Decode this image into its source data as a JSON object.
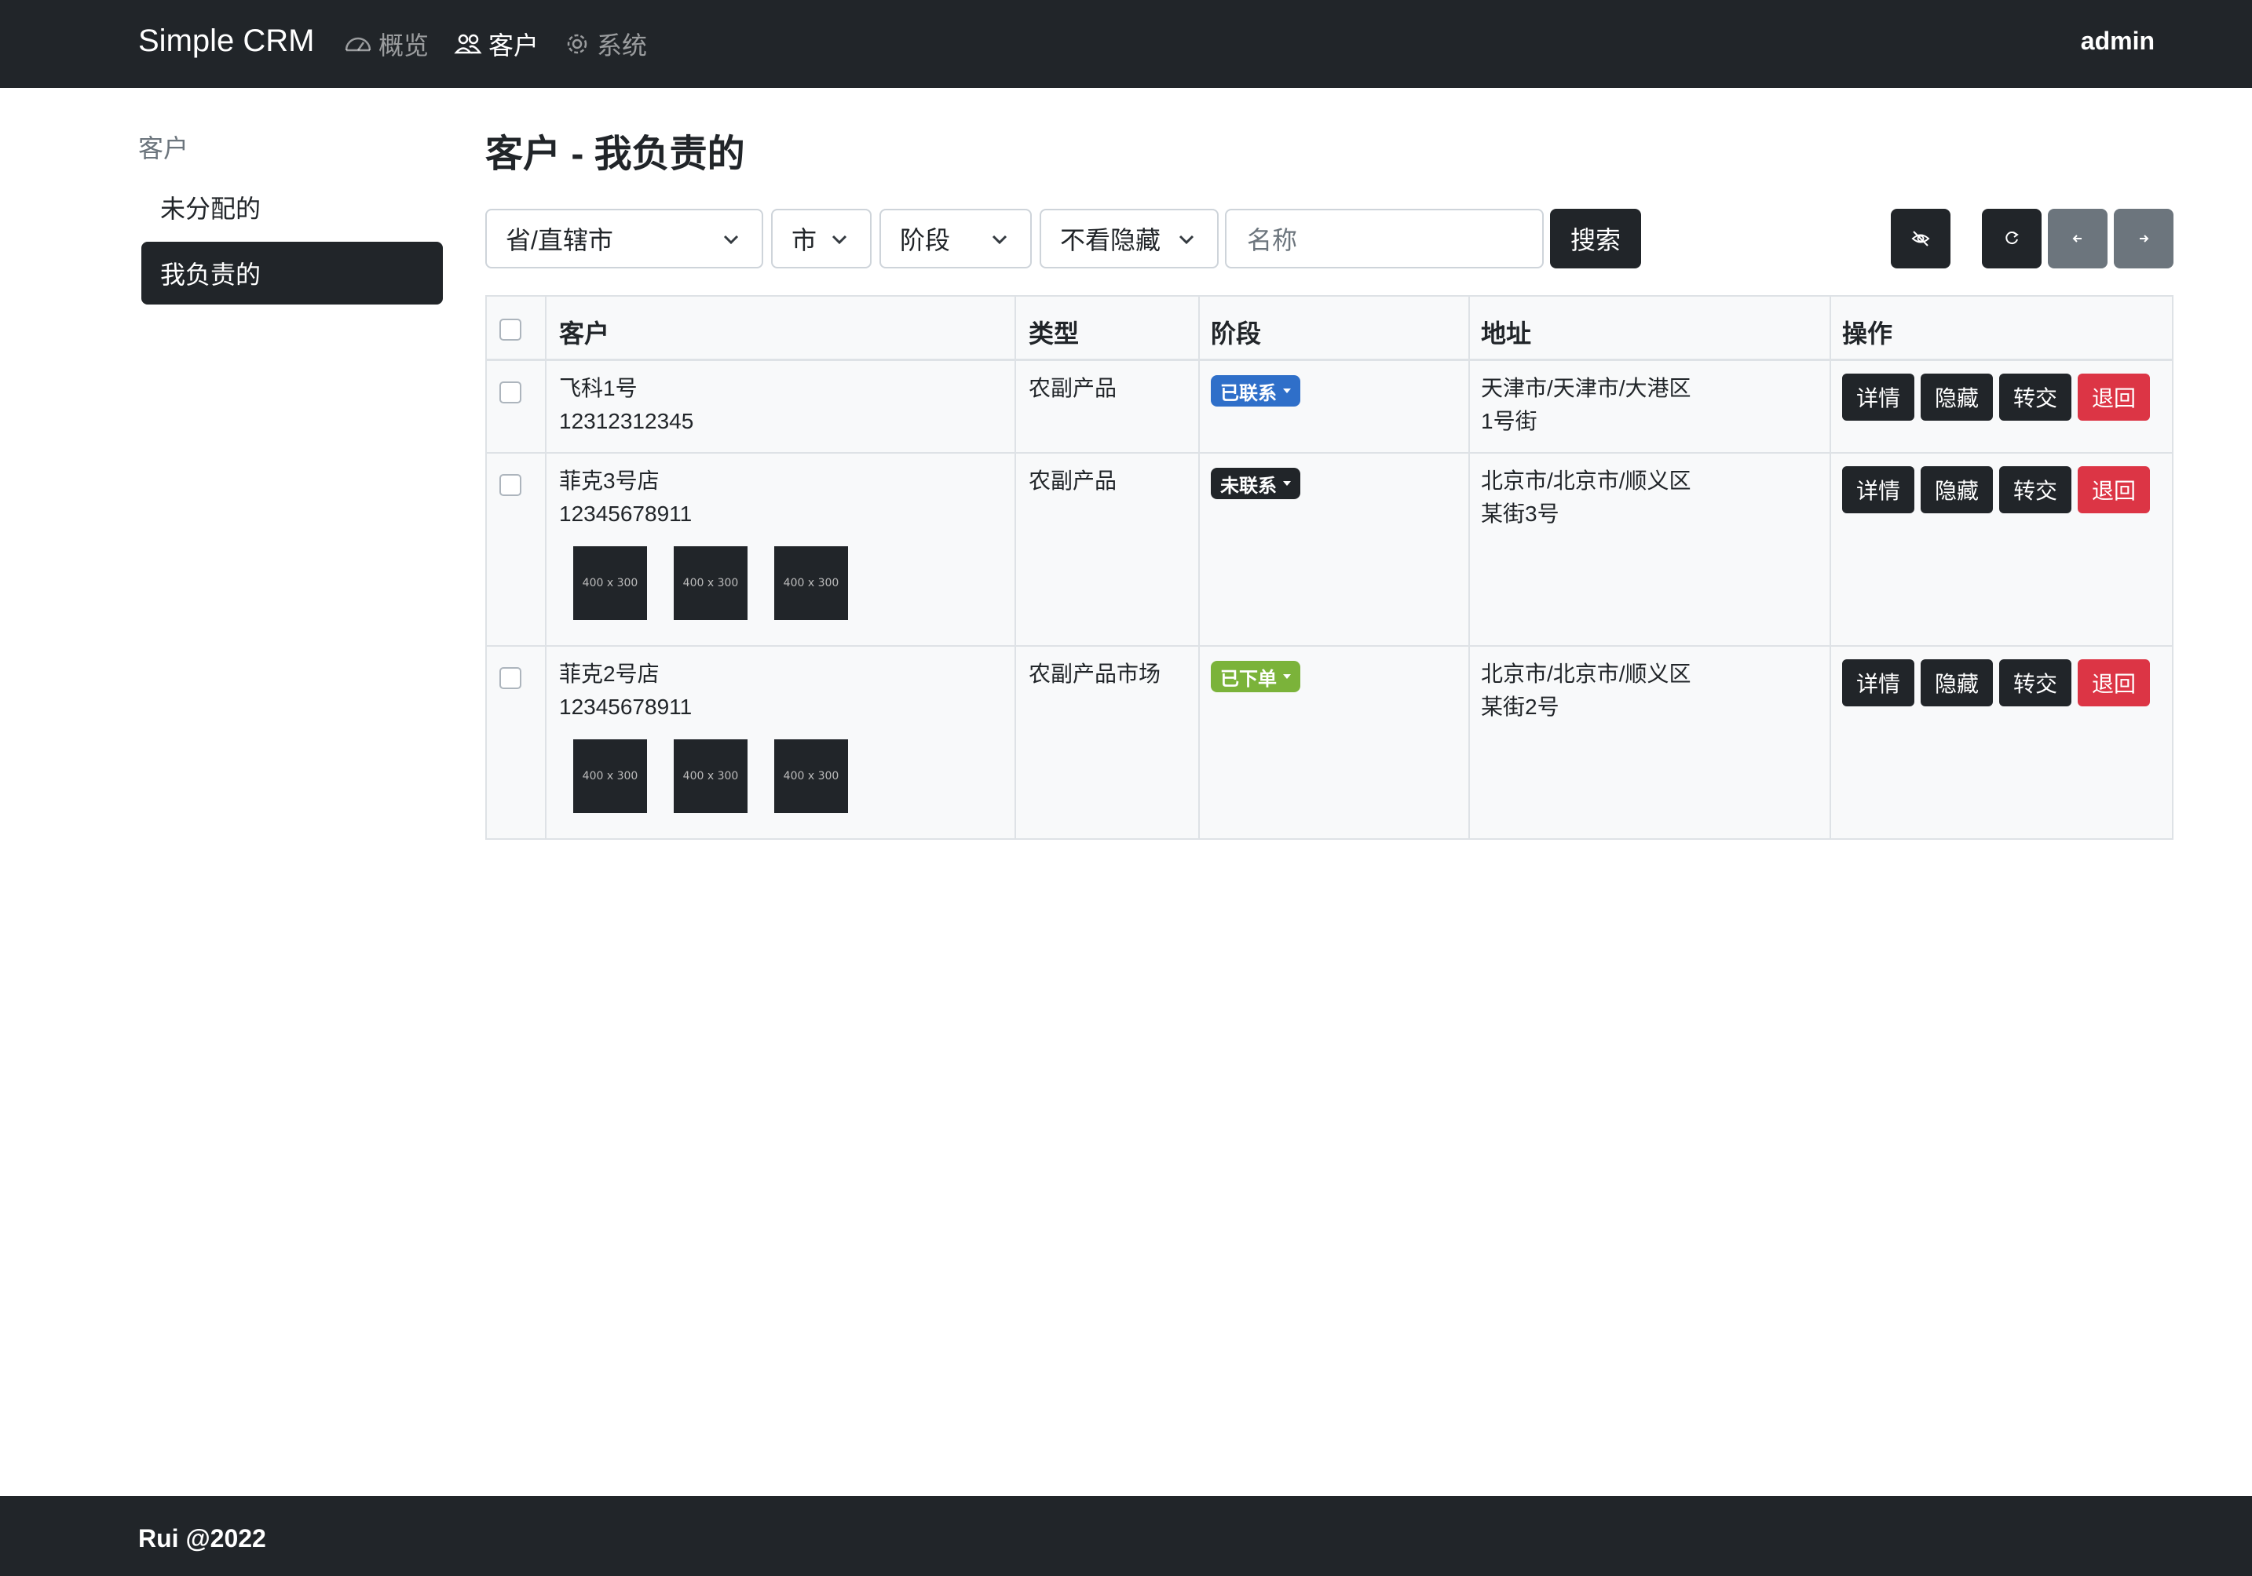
{
  "navbar": {
    "brand": "Simple CRM",
    "items": [
      {
        "label": "概览",
        "icon": "speedometer-icon"
      },
      {
        "label": "客户",
        "icon": "people-icon"
      },
      {
        "label": "系统",
        "icon": "gear-icon"
      }
    ],
    "user": "admin"
  },
  "sidebar": {
    "heading": "客户",
    "items": [
      {
        "label": "未分配的",
        "active": false
      },
      {
        "label": "我负责的",
        "active": true
      }
    ]
  },
  "page": {
    "title": "客户 - 我负责的"
  },
  "filters": {
    "province": "省/直辖市",
    "city": "市",
    "stage": "阶段",
    "hidden": "不看隐藏",
    "name_placeholder": "名称",
    "search_label": "搜索"
  },
  "toolbar": {
    "icons": [
      "eye-slash-icon",
      "refresh-icon",
      "arrow-left-icon",
      "arrow-right-icon"
    ]
  },
  "table": {
    "headers": [
      "客户",
      "类型",
      "阶段",
      "地址",
      "操作"
    ],
    "rows": [
      {
        "name": "飞科1号",
        "phone": "12312312345",
        "type": "农副产品",
        "stage": "已联系",
        "stage_color": "#2f6fc9",
        "address1": "天津市/天津市/大港区",
        "address2": "1号街",
        "thumbs": []
      },
      {
        "name": "菲克3号店",
        "phone": "12345678911",
        "type": "农副产品",
        "stage": "未联系",
        "stage_color": "#212529",
        "address1": "北京市/北京市/顺义区",
        "address2": "某街3号",
        "thumbs": [
          "400 x 300",
          "400 x 300",
          "400 x 300"
        ]
      },
      {
        "name": "菲克2号店",
        "phone": "12345678911",
        "type": "农副产品市场",
        "stage": "已下单",
        "stage_color": "#7bb33a",
        "address1": "北京市/北京市/顺义区",
        "address2": "某街2号",
        "thumbs": [
          "400 x 300",
          "400 x 300",
          "400 x 300"
        ]
      }
    ],
    "actions": [
      "详情",
      "隐藏",
      "转交",
      "退回"
    ]
  },
  "footer": {
    "text": "Rui @2022"
  }
}
